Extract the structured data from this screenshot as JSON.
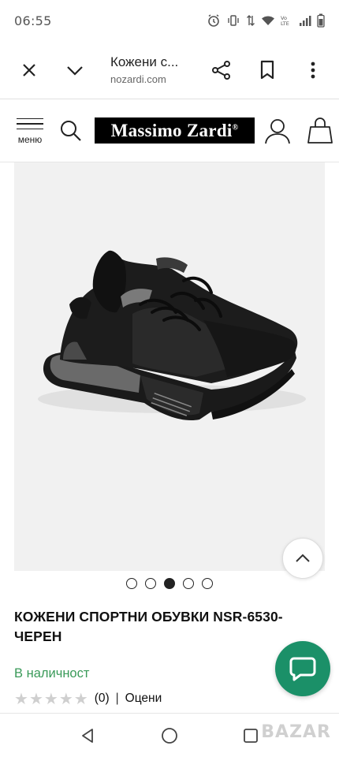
{
  "status_bar": {
    "time": "06:55",
    "icons": [
      "alarm-icon",
      "vibrate-icon",
      "data-arrows-icon",
      "wifi-icon",
      "volte-icon",
      "signal-icon",
      "battery-icon"
    ]
  },
  "browser": {
    "page_title": "Кожени с...",
    "url": "nozardi.com",
    "icons": [
      "close-icon",
      "chevron-down-icon",
      "share-icon",
      "bookmark-icon",
      "more-vert-icon"
    ]
  },
  "site_header": {
    "menu_label": "меню",
    "logo_text": "Massimo Zardi",
    "logo_mark": "®"
  },
  "gallery": {
    "image_alt": "black leather sneaker",
    "slide_count": 5,
    "active_slide": 3
  },
  "product": {
    "title": "КОЖЕНИ СПОРТНИ ОБУВКИ NSR-6530-ЧЕРЕН",
    "availability": "В наличност",
    "rating_stars": 0,
    "rating_max": 5,
    "review_count": "(0)",
    "separator": "|",
    "rate_link": "Оцени"
  },
  "watermark": "BAZAR",
  "colors": {
    "availability_green": "#3a9a59",
    "chat_button": "#1b9068",
    "logo_background": "#000000"
  }
}
